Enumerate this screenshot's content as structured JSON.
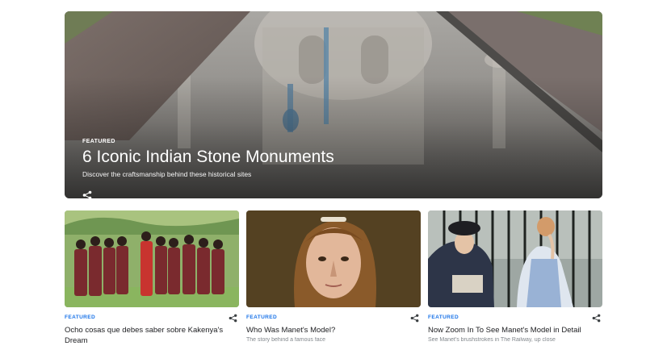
{
  "hero": {
    "kicker": "FEATURED",
    "title": "6 Iconic Indian Stone Monuments",
    "subtitle": "Discover the craftsmanship behind these historical sites",
    "share_icon": "share-icon"
  },
  "cards": [
    {
      "kicker": "FEATURED",
      "title": "Ocho cosas que debes saber sobre Kakenya's Dream",
      "subtitle": "",
      "share_icon": "share-icon"
    },
    {
      "kicker": "FEATURED",
      "title": "Who Was Manet's Model?",
      "subtitle": "The story behind a famous face",
      "share_icon": "share-icon"
    },
    {
      "kicker": "FEATURED",
      "title": "Now Zoom In To See Manet's Model in Detail",
      "subtitle": "See Manet's brushstrokes in The Railway, up close",
      "share_icon": "share-icon"
    }
  ],
  "colors": {
    "accent": "#1a73e8",
    "title": "#202124",
    "muted": "#80868b"
  }
}
